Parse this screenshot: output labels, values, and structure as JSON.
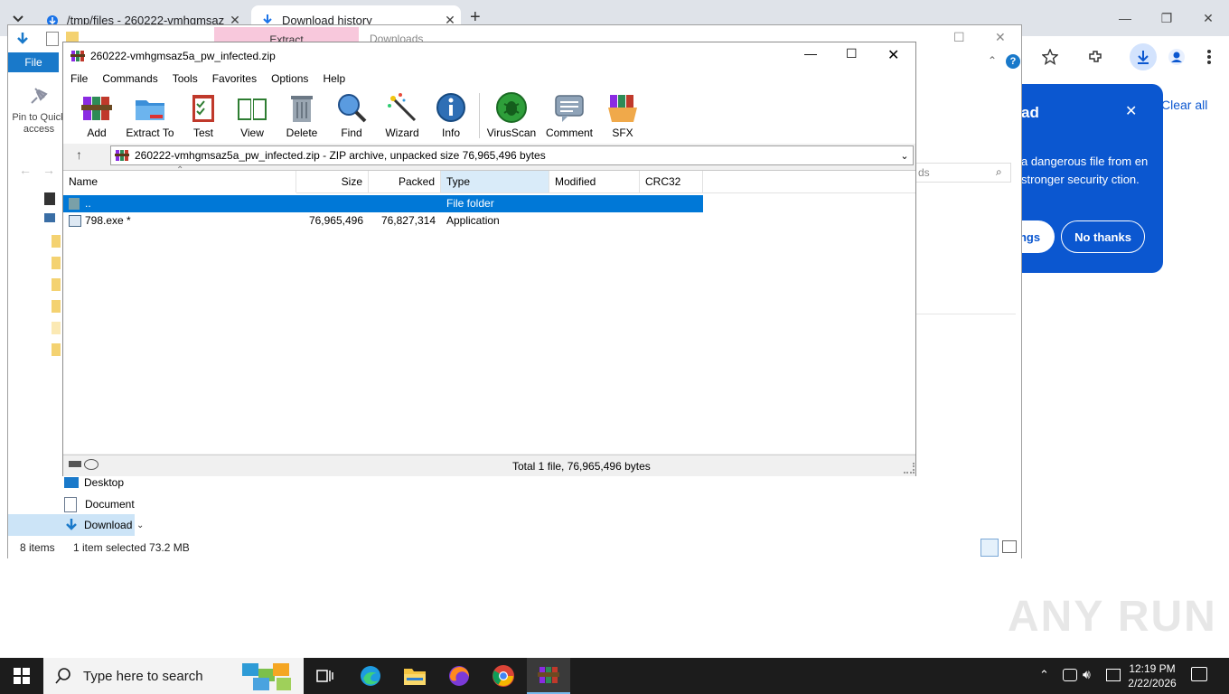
{
  "chrome": {
    "tabs": [
      {
        "label": "/tmp/files - 260222-vmhgmsaz5a",
        "active": false
      },
      {
        "label": "Download history",
        "active": true
      }
    ],
    "new_tab": "+",
    "download_bubble": {
      "title": "ad",
      "text": "a dangerous file from en stronger security ction.",
      "settings_btn": "ngs",
      "no_thanks_btn": "No thanks",
      "clear_all": "Clear all"
    },
    "accent": "#0b57d0"
  },
  "explorer": {
    "file_tab": "File",
    "ribbon": {
      "extract_tab": "Extract",
      "downloads_tab": "Downloads"
    },
    "pin_label_1": "Pin to Quick",
    "pin_label_2": "access",
    "search_hint": "ds",
    "nav": [
      {
        "label": "Desktop",
        "icon": "desktop-icon"
      },
      {
        "label": "Document",
        "icon": "document-icon"
      },
      {
        "label": "Download",
        "icon": "download-icon",
        "selected": true
      }
    ],
    "status": {
      "items": "8 items",
      "selected": "1 item selected  73.2 MB"
    }
  },
  "winrar": {
    "title": "260222-vmhgmsaz5a_pw_infected.zip",
    "menu": [
      "File",
      "Commands",
      "Tools",
      "Favorites",
      "Options",
      "Help"
    ],
    "toolbar": [
      {
        "label": "Add",
        "icon": "add-archive-icon"
      },
      {
        "label": "Extract To",
        "icon": "extract-folder-icon"
      },
      {
        "label": "Test",
        "icon": "test-clipboard-icon"
      },
      {
        "label": "View",
        "icon": "view-book-icon"
      },
      {
        "label": "Delete",
        "icon": "delete-trash-icon"
      },
      {
        "label": "Find",
        "icon": "find-magnifier-icon"
      },
      {
        "label": "Wizard",
        "icon": "wizard-wand-icon"
      },
      {
        "label": "Info",
        "icon": "info-icon"
      },
      {
        "label": "VirusScan",
        "icon": "virusscan-bug-icon"
      },
      {
        "label": "Comment",
        "icon": "comment-icon"
      },
      {
        "label": "SFX",
        "icon": "sfx-box-icon"
      }
    ],
    "address": "260222-vmhgmsaz5a_pw_infected.zip - ZIP archive, unpacked size 76,965,496 bytes",
    "columns": [
      "Name",
      "Size",
      "Packed",
      "Type",
      "Modified",
      "CRC32"
    ],
    "rows": [
      {
        "name": "..",
        "size": "",
        "packed": "",
        "type": "File folder",
        "modified": "",
        "crc": "",
        "selected": true
      },
      {
        "name": "798.exe *",
        "size": "76,965,496",
        "packed": "76,827,314",
        "type": "Application",
        "modified": "",
        "crc": "",
        "selected": false
      }
    ],
    "status": "Total 1 file, 76,965,496 bytes"
  },
  "taskbar": {
    "search_placeholder": "Type here to search",
    "time": "12:19 PM",
    "date": "2/22/2026"
  },
  "watermark": "ANY RUN"
}
